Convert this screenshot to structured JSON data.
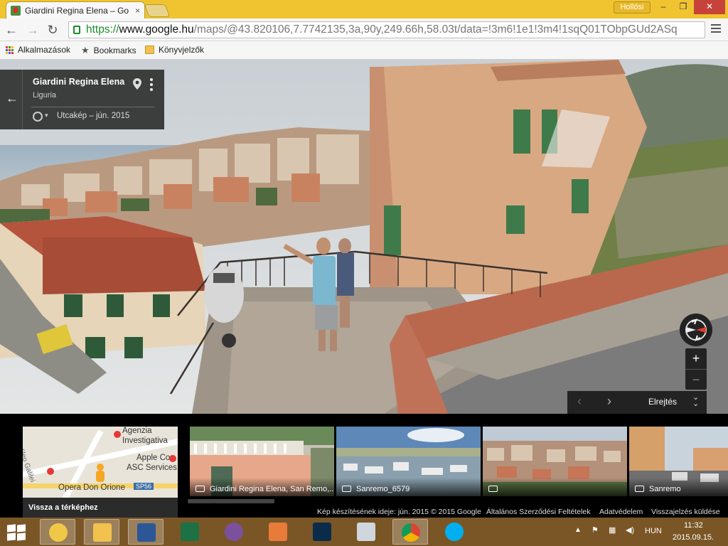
{
  "browser": {
    "tab_title": "Giardini Regina Elena – Go",
    "tab_close": "×",
    "user_label": "Hollósi",
    "window_controls": [
      "–",
      "❐",
      "✕"
    ],
    "url_https": "https://",
    "url_host": "www.google.hu",
    "url_path": "/maps/@43.820106,7.7742135,3a,90y,249.66h,58.03t/data=!3m6!1e1!3m4!1sqQ01TObpGUd2ASq",
    "bookmarks": [
      "Alkalmazások",
      "Bookmarks",
      "Könyvjelzők"
    ]
  },
  "infocard": {
    "place": "Giardini Regina Elena",
    "region": "Liguria",
    "date_label": "Utcakép – jún. 2015",
    "back_glyph": "←"
  },
  "controls": {
    "zoom_in": "+",
    "zoom_out": "−",
    "prev": "‹",
    "next": "›",
    "hide_label": "Elrejtés"
  },
  "filmstrip": {
    "minimap_labels": [
      "Agenzia",
      "Investigativa",
      "Apple Con",
      "ASC Services",
      "Opera Don Orione",
      "Galileo Galilei",
      "SP56"
    ],
    "back_to_map": "Vissza a térképhez",
    "thumbnails": [
      {
        "caption": "Giardini Regina Elena, San Remo,..."
      },
      {
        "caption": "Sanremo_6579"
      },
      {
        "caption": ""
      },
      {
        "caption": "Sanremo"
      }
    ]
  },
  "footer": {
    "capture_date": "Kép készítésének ideje: jún. 2015",
    "copyright": "© 2015 Google",
    "terms": "Általános Szerződési Feltételek",
    "privacy": "Adatvédelem",
    "feedback": "Visszajelzés küldése"
  },
  "taskbar": {
    "language": "HUN",
    "time": "11:32",
    "date": "2015.09.15."
  },
  "colors": {
    "titlebar": "#f0c430",
    "taskbar": "#7a5626",
    "https_green": "#1a8c2a"
  }
}
